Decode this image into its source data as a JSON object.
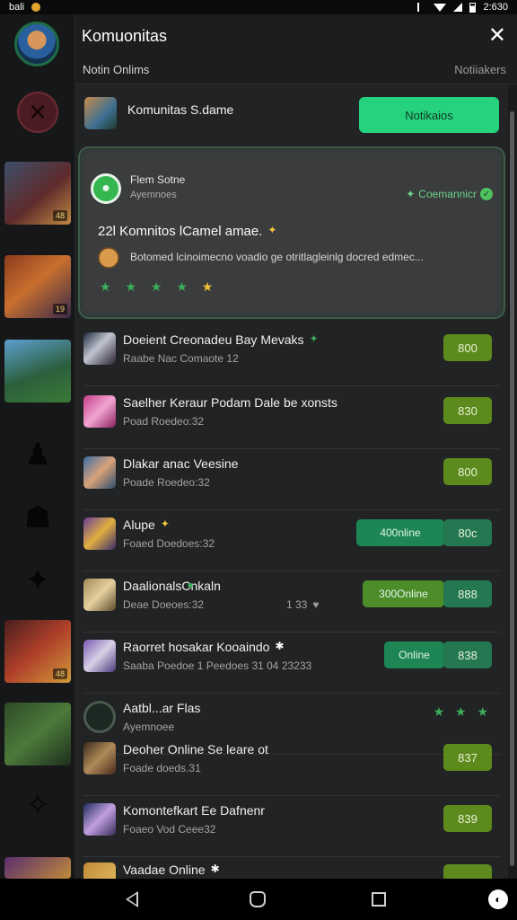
{
  "status_bar": {
    "left_text": "bali",
    "time": "2:630"
  },
  "header": {
    "title": "Komuonitas",
    "subtitle_left": "Notin Onlims",
    "subtitle_right": "Notiiakers"
  },
  "top_row": {
    "title": "Komunitas S.dame",
    "button_label": "Notikaios"
  },
  "featured_card": {
    "title": "Flem Sotne",
    "subtitle": "Ayemnoes",
    "badge_label": "Coemannicr",
    "headline": "22l Komnitos lCamel amae.",
    "description": "Botomed lcinoimecno voadio ge otritlagleinlg docred edmec...",
    "stars": "★ ★ ★ ★"
  },
  "rows": [
    {
      "title": "Doeient Creonadeu Bay Mevaks",
      "subtitle": "Raabe Nac Comaote 12",
      "price": "800"
    },
    {
      "title": "Saelher Keraur Podam Dale be xonsts",
      "subtitle": "Poad Roedeo:32",
      "price": "830"
    },
    {
      "title": "Dlakar anac Veesine",
      "subtitle": "Poade Roedeo:32",
      "price": "800"
    },
    {
      "title": "Alupe",
      "subtitle": "Foaed Doedoes:32",
      "online_label": "400nline",
      "price": "80c"
    },
    {
      "title": "Daalionals",
      "title_suffix": "Cnkaln",
      "subtitle": "Deae Doeoes:32",
      "meta": "1 33",
      "online_label": "300Online",
      "price": "888"
    },
    {
      "title": "Raorret hosakar Kooaindo",
      "subtitle": "Saaba Poedoe 1 Peedoes 31 04 23233",
      "online_label": "Online",
      "price": "838"
    },
    {
      "title": "Aatbl...ar Flas",
      "subtitle": "Ayemnoee",
      "stars": "★ ★ ★"
    },
    {
      "title": "Deoher Online Se leare ot",
      "subtitle": "Foade doeds.31",
      "price": "837"
    },
    {
      "title": "Komontefkart Ee Dafnenr",
      "subtitle": "Foaeo Vod Ceee32",
      "price": "839"
    },
    {
      "title": "Vaadae Online",
      "subtitle": ""
    }
  ],
  "rail": {
    "tile_tags": [
      "48",
      "19",
      "",
      "48"
    ]
  },
  "colors": {
    "accent_green": "#27d27f",
    "price_green": "#5d8a1d",
    "price_teal": "#237852",
    "background": "#222324"
  },
  "icons": {
    "header_close": "close-icon",
    "rail_close": "x-icon",
    "card_badge": "check-icon",
    "nav": [
      "back-icon",
      "home-icon",
      "recent-apps-icon",
      "assistant-icon"
    ]
  }
}
